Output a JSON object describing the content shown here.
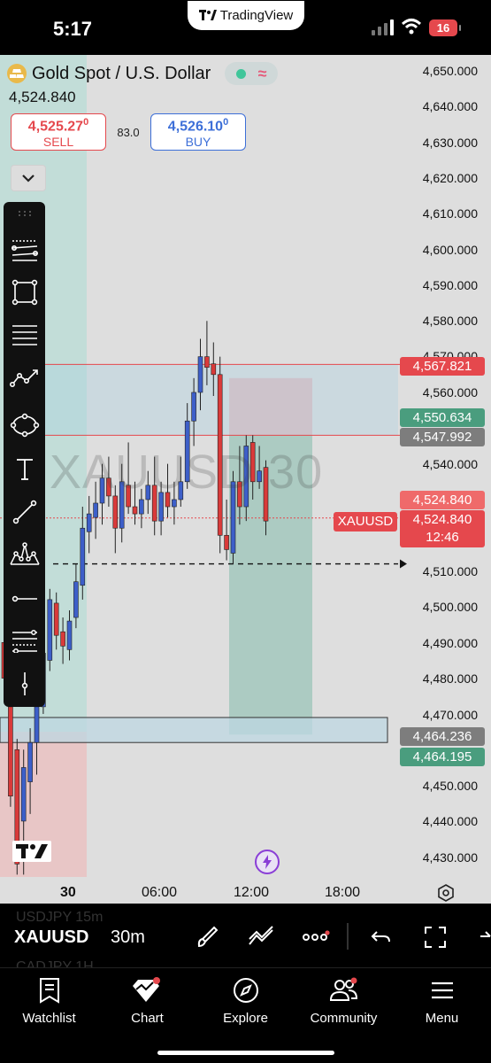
{
  "status_bar": {
    "time": "5:17",
    "app_pill": "TradingView",
    "battery": "16"
  },
  "symbol": {
    "title": "Gold Spot / U.S. Dollar",
    "last_price": "4,524.840",
    "sell_price": "4,525.27",
    "sell_price_sup": "0",
    "sell_label": "SELL",
    "spread": "83.0",
    "buy_price": "4,526.10",
    "buy_price_sup": "0",
    "buy_label": "BUY"
  },
  "watermark": "XAUUSD 30",
  "price_axis": [
    "4,650.000",
    "4,640.000",
    "4,630.000",
    "4,620.000",
    "4,610.000",
    "4,600.000",
    "4,590.000",
    "4,580.000",
    "4,570.000",
    "4,560.000",
    "4,540.000",
    "4,510.000",
    "4,500.000",
    "4,490.000",
    "4,480.000",
    "4,470.000",
    "4,450.000",
    "4,440.000",
    "4,430.000"
  ],
  "price_tags": {
    "resistance": "4,567.821",
    "take_profit": "4,550.634",
    "entry": "4,547.992",
    "last_price": "4,524.840",
    "symbol_tag": "XAUUSD",
    "current_price": "4,524.840",
    "countdown": "12:46",
    "zone_top": "4,464.236",
    "zone_bottom": "4,464.195"
  },
  "time_axis": [
    "30",
    "06:00",
    "12:00",
    "18:00"
  ],
  "bottom_toolbar": {
    "symbol": "XAUUSD",
    "interval": "30m",
    "ghost_rows": [
      "USDJPY   15m",
      "CADJPY   1H"
    ]
  },
  "tabs": [
    {
      "label": "Watchlist"
    },
    {
      "label": "Chart"
    },
    {
      "label": "Explore"
    },
    {
      "label": "Community"
    },
    {
      "label": "Menu"
    }
  ],
  "colors": {
    "up": "#3d5fc9",
    "down": "#d93a3a",
    "accent_red": "#e5484d",
    "accent_green": "#4a9d7e",
    "chart_bg": "#dedede"
  },
  "chart_data": {
    "type": "candlestick",
    "title": "Gold Spot / U.S. Dollar",
    "interval": "30m",
    "ylim": [
      4425,
      4655
    ],
    "x_ticks": [
      "30",
      "06:00",
      "12:00",
      "18:00"
    ],
    "candles": [
      {
        "o": 4490,
        "h": 4506,
        "l": 4474,
        "c": 4480
      },
      {
        "o": 4472,
        "h": 4474,
        "l": 4444,
        "c": 4447
      },
      {
        "o": 4460,
        "h": 4463,
        "l": 4425,
        "c": 4428
      },
      {
        "o": 4440,
        "h": 4460,
        "l": 4425,
        "c": 4455
      },
      {
        "o": 4451,
        "h": 4466,
        "l": 4442,
        "c": 4462
      },
      {
        "o": 4462,
        "h": 4478,
        "l": 4453,
        "c": 4472
      },
      {
        "o": 4472,
        "h": 4490,
        "l": 4470,
        "c": 4487
      },
      {
        "o": 4485,
        "h": 4505,
        "l": 4482,
        "c": 4502
      },
      {
        "o": 4501,
        "h": 4504,
        "l": 4488,
        "c": 4492
      },
      {
        "o": 4493,
        "h": 4497,
        "l": 4484,
        "c": 4489
      },
      {
        "o": 4488,
        "h": 4499,
        "l": 4485,
        "c": 4496
      },
      {
        "o": 4497,
        "h": 4512,
        "l": 4494,
        "c": 4507
      },
      {
        "o": 4506,
        "h": 4528,
        "l": 4502,
        "c": 4522
      },
      {
        "o": 4521,
        "h": 4531,
        "l": 4515,
        "c": 4526
      },
      {
        "o": 4525,
        "h": 4535,
        "l": 4519,
        "c": 4529
      },
      {
        "o": 4529,
        "h": 4540,
        "l": 4523,
        "c": 4536
      },
      {
        "o": 4536,
        "h": 4542,
        "l": 4528,
        "c": 4531
      },
      {
        "o": 4531,
        "h": 4534,
        "l": 4515,
        "c": 4522
      },
      {
        "o": 4522,
        "h": 4540,
        "l": 4518,
        "c": 4535
      },
      {
        "o": 4534,
        "h": 4546,
        "l": 4526,
        "c": 4528
      },
      {
        "o": 4528,
        "h": 4535,
        "l": 4523,
        "c": 4526
      },
      {
        "o": 4526,
        "h": 4533,
        "l": 4522,
        "c": 4530
      },
      {
        "o": 4530,
        "h": 4538,
        "l": 4526,
        "c": 4534
      },
      {
        "o": 4534,
        "h": 4542,
        "l": 4520,
        "c": 4524
      },
      {
        "o": 4524,
        "h": 4535,
        "l": 4520,
        "c": 4532
      },
      {
        "o": 4532,
        "h": 4540,
        "l": 4525,
        "c": 4528
      },
      {
        "o": 4528,
        "h": 4535,
        "l": 4523,
        "c": 4530
      },
      {
        "o": 4530,
        "h": 4542,
        "l": 4528,
        "c": 4535
      },
      {
        "o": 4535,
        "h": 4557,
        "l": 4533,
        "c": 4552
      },
      {
        "o": 4552,
        "h": 4564,
        "l": 4545,
        "c": 4560
      },
      {
        "o": 4560,
        "h": 4575,
        "l": 4555,
        "c": 4570
      },
      {
        "o": 4570,
        "h": 4580,
        "l": 4562,
        "c": 4567
      },
      {
        "o": 4568,
        "h": 4574,
        "l": 4559,
        "c": 4565
      },
      {
        "o": 4565,
        "h": 4570,
        "l": 4515,
        "c": 4520
      },
      {
        "o": 4520,
        "h": 4530,
        "l": 4513,
        "c": 4516
      },
      {
        "o": 4515,
        "h": 4538,
        "l": 4512,
        "c": 4535
      },
      {
        "o": 4535,
        "h": 4545,
        "l": 4523,
        "c": 4528
      },
      {
        "o": 4528,
        "h": 4548,
        "l": 4524,
        "c": 4545
      },
      {
        "o": 4546,
        "h": 4548,
        "l": 4530,
        "c": 4535
      },
      {
        "o": 4535,
        "h": 4545,
        "l": 4533,
        "c": 4538
      },
      {
        "o": 4539,
        "h": 4541,
        "l": 4520,
        "c": 4524
      }
    ],
    "levels": [
      {
        "price": 4567.821,
        "color": "#e5484d",
        "style": "solid"
      },
      {
        "price": 4547.992,
        "color": "#e5484d",
        "style": "solid"
      },
      {
        "price": 4524.84,
        "color": "#e5484d",
        "style": "dotted"
      },
      {
        "price": 4512.0,
        "color": "#111111",
        "style": "dashed"
      }
    ],
    "zone": {
      "top": 4464.236,
      "bottom": 4464.195
    },
    "position": {
      "entry": 4547.992,
      "stop": 4564.0,
      "target": 4464.2
    }
  }
}
